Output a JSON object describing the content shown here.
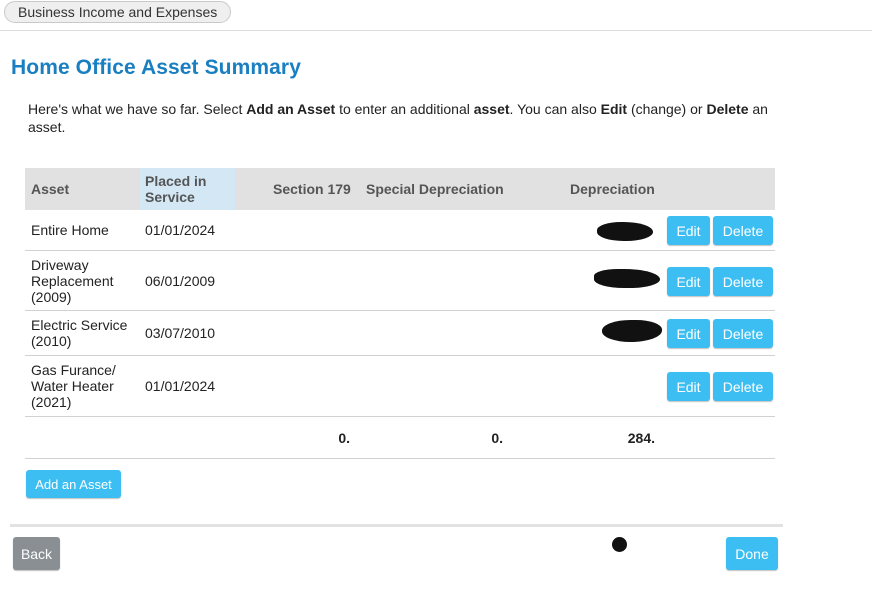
{
  "breadcrumb": {
    "label": "Business Income and Expenses"
  },
  "page": {
    "title": "Home Office Asset Summary"
  },
  "intro": {
    "t1": "Here's what we have so far. Select ",
    "b1": "Add an Asset",
    "t2": " to enter an additional ",
    "b2": "asset",
    "t3": ". You can also ",
    "b3": "Edit",
    "t4": " (change) or ",
    "b4": "Delete",
    "t5": " an asset."
  },
  "table": {
    "headers": {
      "asset": "Asset",
      "placed": "Placed in Service",
      "section179": "Section 179",
      "special": "Special Depreciation",
      "depreciation": "Depreciation"
    },
    "rows": [
      {
        "asset": "Entire Home",
        "placed": "01/01/2024"
      },
      {
        "asset": "Driveway Replacement (2009)",
        "placed": "06/01/2009"
      },
      {
        "asset": "Electric Service (2010)",
        "placed": "03/07/2010"
      },
      {
        "asset": "Gas Furance/ Water Heater (2021)",
        "placed": "01/01/2024"
      }
    ],
    "totals": {
      "section179": "0.",
      "special": "0.",
      "depreciation": "284."
    },
    "edit_label": "Edit",
    "delete_label": "Delete"
  },
  "actions": {
    "add_asset": "Add an Asset",
    "back": "Back",
    "done": "Done"
  },
  "colors": {
    "accent": "#3dbef2",
    "title": "#1a7fc1",
    "header_bg": "#e1e1e1",
    "placed_header_bg": "#d3e7f5",
    "back_bg": "#8a8f93"
  }
}
